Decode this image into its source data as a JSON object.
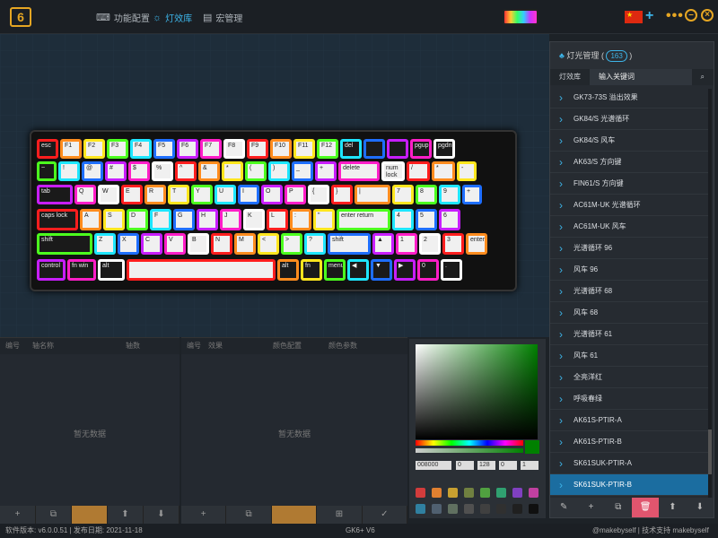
{
  "app": {
    "logo": "6",
    "nav": [
      {
        "label": "功能配置",
        "icon": "keyboard-icon"
      },
      {
        "label": "灯效库",
        "icon": "sun-icon"
      },
      {
        "label": "宏管理",
        "icon": "document-icon"
      }
    ],
    "flag": "★"
  },
  "keys": [
    [
      "esc",
      "F1",
      "F2",
      "F3",
      "F4",
      "F5",
      "F6",
      "F7",
      "F8",
      "F9",
      "F10",
      "F11",
      "F12",
      "del",
      "",
      "",
      "pgup",
      "pgdn"
    ],
    [
      "~",
      "!",
      "@",
      "#",
      "$",
      "%",
      "^",
      "&",
      "*",
      "(",
      ")",
      "_",
      "+",
      "delete",
      "num lock",
      "/",
      "*",
      "-"
    ],
    [
      "tab",
      "Q",
      "W",
      "E",
      "R",
      "T",
      "Y",
      "U",
      "I",
      "O",
      "P",
      "{",
      "}",
      "|",
      "7",
      "8",
      "9",
      "+"
    ],
    [
      "caps lock",
      "A",
      "S",
      "D",
      "F",
      "G",
      "H",
      "J",
      "K",
      "L",
      ":",
      "\"",
      "enter return",
      "4",
      "5",
      "6"
    ],
    [
      "shift",
      "Z",
      "X",
      "C",
      "V",
      "B",
      "N",
      "M",
      "<",
      ">",
      "?",
      "shift",
      "▲",
      "1",
      "2",
      "3",
      "enter"
    ],
    [
      "control",
      "fn win",
      "alt",
      "",
      "alt",
      "fn",
      "menu",
      "◀",
      "▼",
      "▶",
      "0",
      "."
    ]
  ],
  "bottom": {
    "left": {
      "headers": [
        "编号",
        "轴名称",
        "轴数"
      ],
      "empty": "暂无数据",
      "tools": [
        "+",
        "⧉",
        "",
        "⬆",
        "⬇"
      ]
    },
    "mid": {
      "headers": [
        "编号",
        "效果",
        "颜色配置",
        "颜色参数"
      ],
      "empty": "暂无数据",
      "tools": [
        "+",
        "⧉",
        "",
        "⊞",
        "✓"
      ]
    }
  },
  "color": {
    "hex": "008000",
    "r": "0",
    "g": "128",
    "b": "0",
    "a": "1",
    "swatches": [
      "#d23c3c",
      "#e08030",
      "#c8a030",
      "#708040",
      "#50a040",
      "#30a070",
      "#8040c0",
      "#c040a0",
      "#3080a0",
      "#506070",
      "#607060",
      "#505050",
      "#404040",
      "#303030",
      "#202020",
      "#101010"
    ]
  },
  "rpanel": {
    "title": "灯光管理",
    "count": "163",
    "tab1": "灯效库",
    "tab2": "输入关键词",
    "items": [
      "GK73-73S 溢出效果",
      "GK84/S 光谱循环",
      "GK84/S 风车",
      "AK63/S 方向键",
      "FIN61/S 方向键",
      "AC61M-UK 光谱循环",
      "AC61M-UK 风车",
      "光谱循环 96",
      "风车 96",
      "光谱循环 68",
      "风车 68",
      "光谱循环 61",
      "风车 61",
      "全亮洋红",
      "呼吸春绿",
      "AK61S-PTIR-A",
      "AK61S-PTIR-B",
      "SK61SUK-PTIR-A",
      "SK61SUK-PTIR-B"
    ],
    "tools": [
      "✎",
      "+",
      "⧉",
      "🗑",
      "⬆",
      "⬇"
    ]
  },
  "status": {
    "version": "软件版本: v6.0.0.51 | 发布日期: 2021-11-18",
    "model": "GK6+ V6",
    "watermark": "@makebyself | 技术支持 makebyself"
  }
}
